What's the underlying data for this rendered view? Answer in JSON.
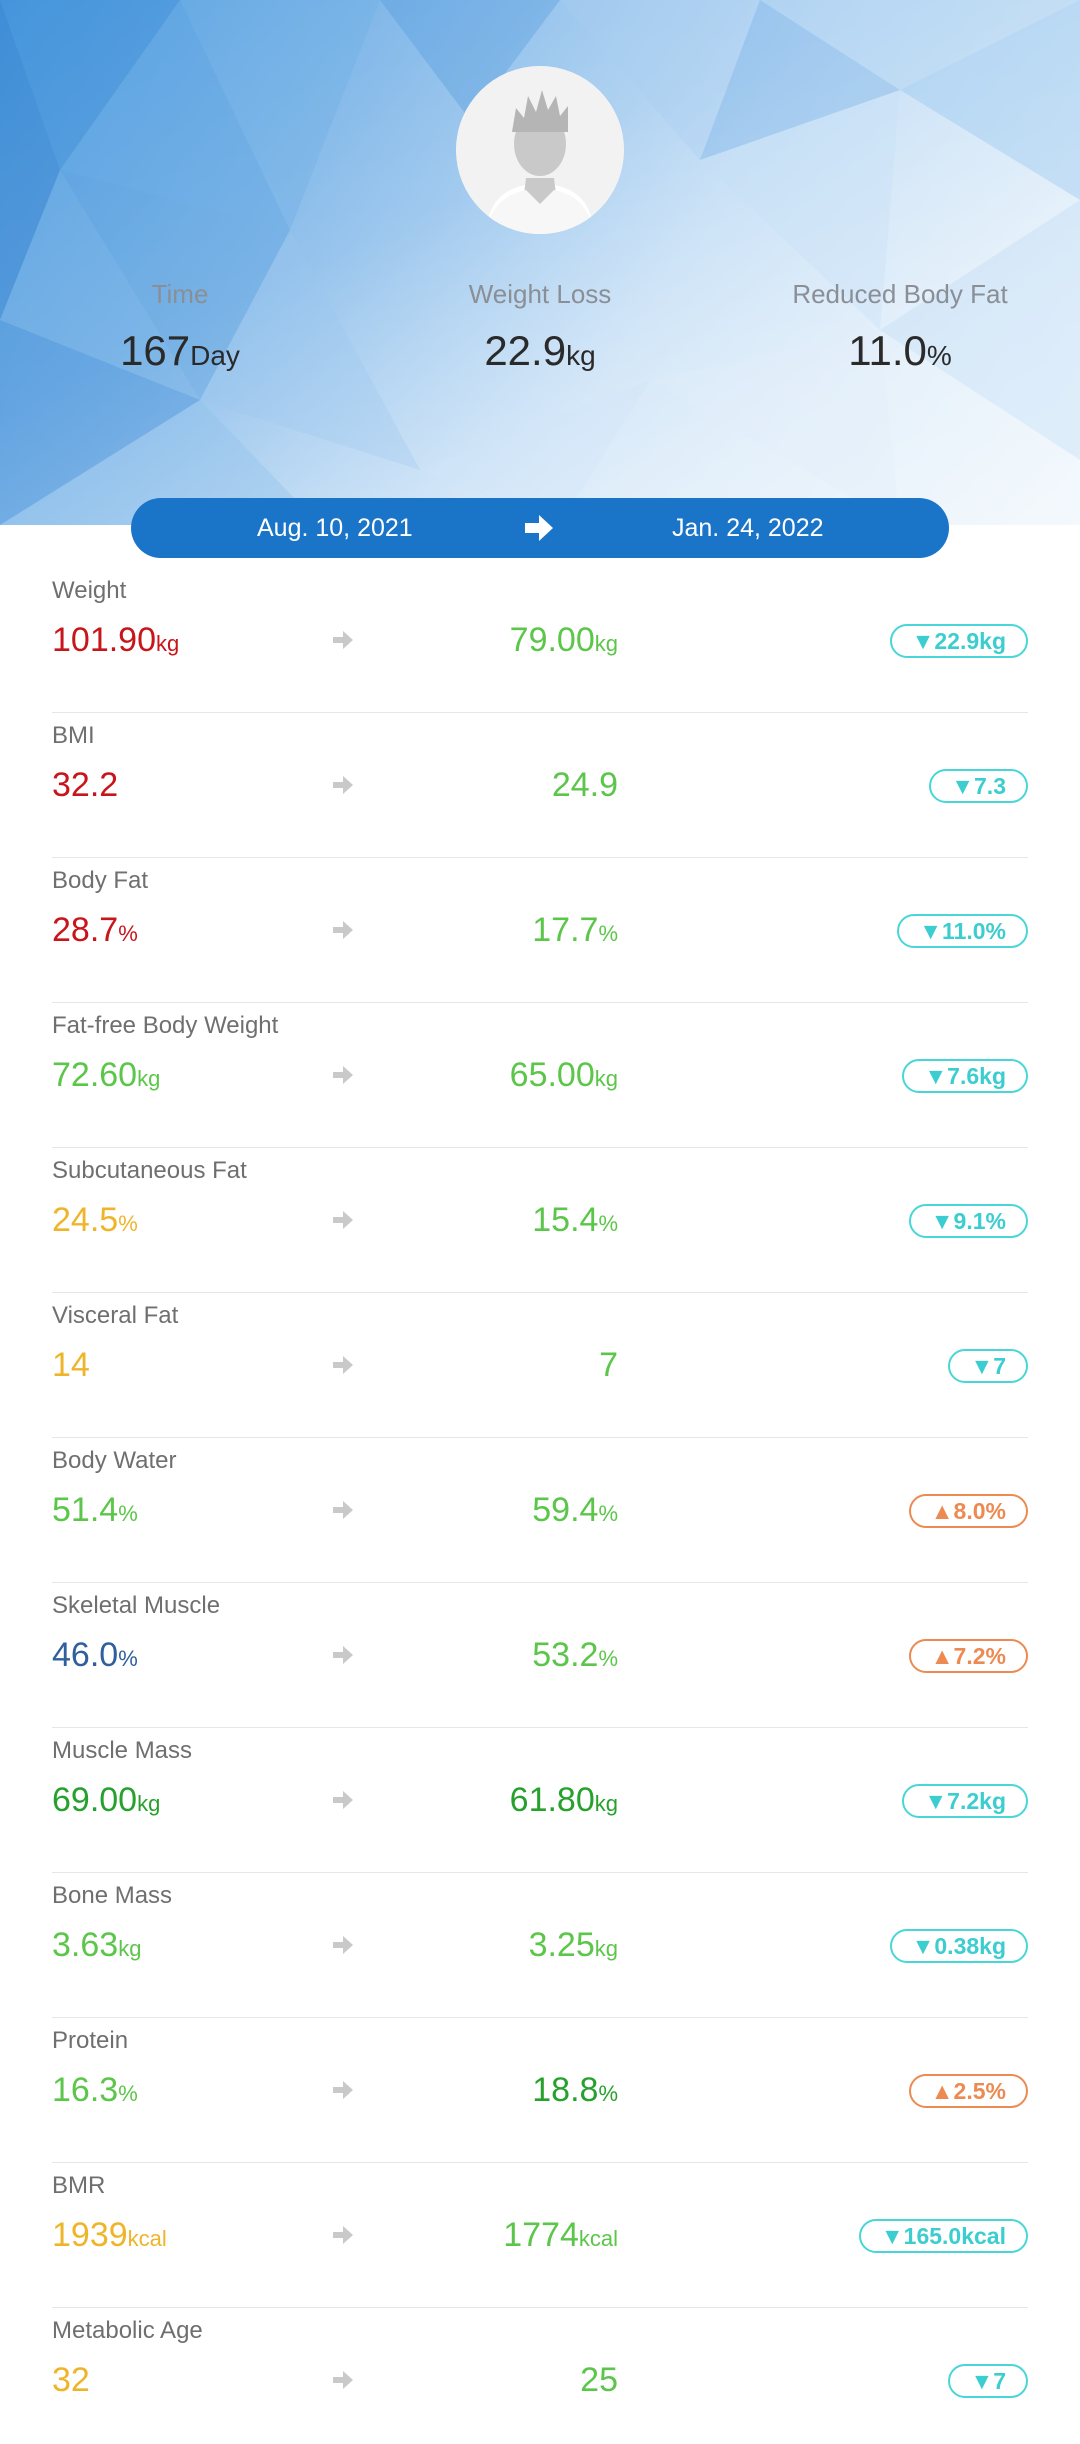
{
  "summary": {
    "time": {
      "label": "Time",
      "value": "167",
      "unit": "Day"
    },
    "weight_loss": {
      "label": "Weight Loss",
      "value": "22.9",
      "unit": "kg"
    },
    "reduced_body_fat": {
      "label": "Reduced Body Fat",
      "value": "11.0",
      "unit": "%"
    }
  },
  "date_range": {
    "start": "Aug. 10, 2021",
    "end": "Jan. 24, 2022"
  },
  "colors": {
    "brand_blue": "#1a74c8",
    "decrease_badge": "#48d6d8",
    "increase_badge": "#ec8a52",
    "high": "#c8151b",
    "standard": "#5cc64a",
    "good": "#27a12d",
    "moderate": "#efb52a",
    "low": "#2f5f9c"
  },
  "metrics": [
    {
      "name": "Weight",
      "from": "101.90",
      "from_unit": "kg",
      "to": "79.00",
      "to_unit": "kg",
      "change": "▼22.9kg",
      "direction": "down",
      "from_color": "red",
      "to_color": "green"
    },
    {
      "name": "BMI",
      "from": "32.2",
      "from_unit": "",
      "to": "24.9",
      "to_unit": "",
      "change": "▼7.3",
      "direction": "down",
      "from_color": "red",
      "to_color": "green"
    },
    {
      "name": "Body Fat",
      "from": "28.7",
      "from_unit": "%",
      "to": "17.7",
      "to_unit": "%",
      "change": "▼11.0%",
      "direction": "down",
      "from_color": "red",
      "to_color": "green"
    },
    {
      "name": "Fat-free Body Weight",
      "from": "72.60",
      "from_unit": "kg",
      "to": "65.00",
      "to_unit": "kg",
      "change": "▼7.6kg",
      "direction": "down",
      "from_color": "green",
      "to_color": "green"
    },
    {
      "name": "Subcutaneous Fat",
      "from": "24.5",
      "from_unit": "%",
      "to": "15.4",
      "to_unit": "%",
      "change": "▼9.1%",
      "direction": "down",
      "from_color": "yellow",
      "to_color": "green"
    },
    {
      "name": "Visceral Fat",
      "from": "14",
      "from_unit": "",
      "to": "7",
      "to_unit": "",
      "change": "▼7",
      "direction": "down",
      "from_color": "yellow",
      "to_color": "green"
    },
    {
      "name": "Body Water",
      "from": "51.4",
      "from_unit": "%",
      "to": "59.4",
      "to_unit": "%",
      "change": "▲8.0%",
      "direction": "up",
      "from_color": "green",
      "to_color": "green"
    },
    {
      "name": "Skeletal Muscle",
      "from": "46.0",
      "from_unit": "%",
      "to": "53.2",
      "to_unit": "%",
      "change": "▲7.2%",
      "direction": "up",
      "from_color": "blue",
      "to_color": "green"
    },
    {
      "name": "Muscle Mass",
      "from": "69.00",
      "from_unit": "kg",
      "to": "61.80",
      "to_unit": "kg",
      "change": "▼7.2kg",
      "direction": "down",
      "from_color": "dgreen",
      "to_color": "dgreen"
    },
    {
      "name": "Bone Mass",
      "from": "3.63",
      "from_unit": "kg",
      "to": "3.25",
      "to_unit": "kg",
      "change": "▼0.38kg",
      "direction": "down",
      "from_color": "green",
      "to_color": "green"
    },
    {
      "name": "Protein",
      "from": "16.3",
      "from_unit": "%",
      "to": "18.8",
      "to_unit": "%",
      "change": "▲2.5%",
      "direction": "up",
      "from_color": "green",
      "to_color": "dgreen"
    },
    {
      "name": "BMR",
      "from": "1939",
      "from_unit": "kcal",
      "to": "1774",
      "to_unit": "kcal",
      "change": "▼165.0kcal",
      "direction": "down",
      "from_color": "yellow",
      "to_color": "green"
    },
    {
      "name": "Metabolic Age",
      "from": "32",
      "from_unit": "",
      "to": "25",
      "to_unit": "",
      "change": "▼7",
      "direction": "down",
      "from_color": "yellow",
      "to_color": "green"
    }
  ]
}
